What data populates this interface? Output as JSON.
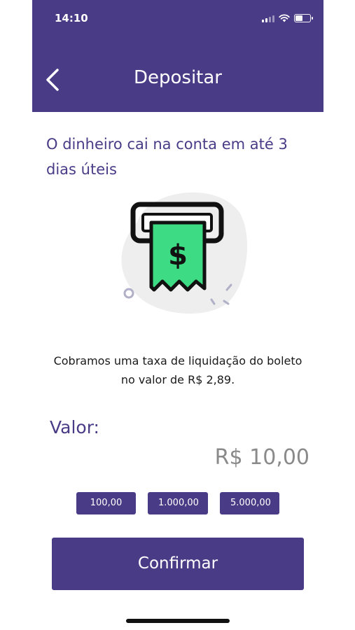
{
  "status_bar": {
    "time": "14:10",
    "icons": [
      "cellular-signal-icon",
      "wifi-icon",
      "battery-icon"
    ],
    "battery_level": 0.5
  },
  "header": {
    "title": "Depositar",
    "back_icon": "chevron-left-icon",
    "background_color": "#4a3b86"
  },
  "delivery_info": "O dinheiro cai na conta em até 3 dias úteis",
  "illustration": {
    "icon": "boleto-receipt-dollar-icon",
    "symbol": "$",
    "accent_color": "#3ddc84"
  },
  "fee_info": "Cobramos uma taxa de liquidação do boleto no valor de R$ 2,89.",
  "amount": {
    "label": "Valor:",
    "value": "R$ 10,00"
  },
  "quick_amounts": [
    "100,00",
    "1.000,00",
    "5.000,00"
  ],
  "confirm_button": {
    "label": "Confirmar"
  }
}
